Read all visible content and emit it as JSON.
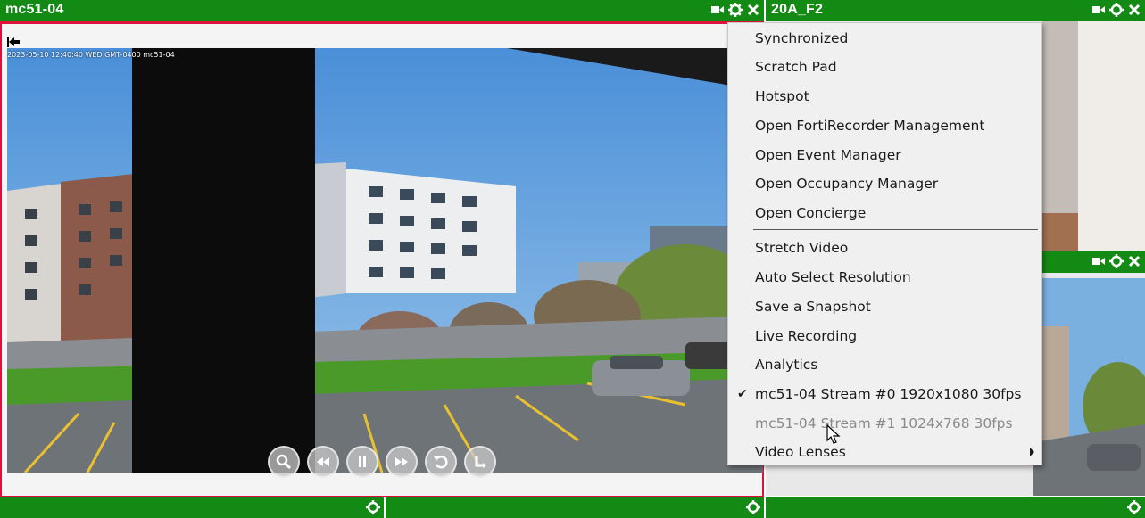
{
  "panels": {
    "main": {
      "title": "mc51-04",
      "timestamp": "2023-05-10 12:40:40 WED GMT-0400 mc51-04"
    },
    "right_top": {
      "title": "20A_F2"
    },
    "right_mid": {
      "title": ""
    }
  },
  "icons": {
    "camera": "camera-icon",
    "gear": "gear-icon",
    "close": "close-icon",
    "back": "back-arrow-icon"
  },
  "playback_controls": [
    "zoom",
    "rewind",
    "pause",
    "fast-forward",
    "replay",
    "jump-to-live"
  ],
  "context_menu": {
    "items": [
      {
        "label": "Synchronized"
      },
      {
        "label": "Scratch Pad"
      },
      {
        "label": "Hotspot"
      },
      {
        "label": "Open FortiRecorder Management"
      },
      {
        "label": "Open Event Manager"
      },
      {
        "label": "Open Occupancy Manager"
      },
      {
        "label": "Open Concierge"
      },
      {
        "label": "Stretch Video"
      },
      {
        "label": "Auto Select Resolution"
      },
      {
        "label": "Save a Snapshot"
      },
      {
        "label": "Live Recording"
      },
      {
        "label": "Analytics"
      },
      {
        "label": "mc51-04 Stream #0 1920x1080 30fps",
        "checked": true
      },
      {
        "label": "mc51-04 Stream #1 1024x768 30fps",
        "disabled": true
      },
      {
        "label": "Video Lenses",
        "submenu": true
      }
    ]
  },
  "colors": {
    "titlebar": "#138a13",
    "active_border": "#e0103c"
  }
}
